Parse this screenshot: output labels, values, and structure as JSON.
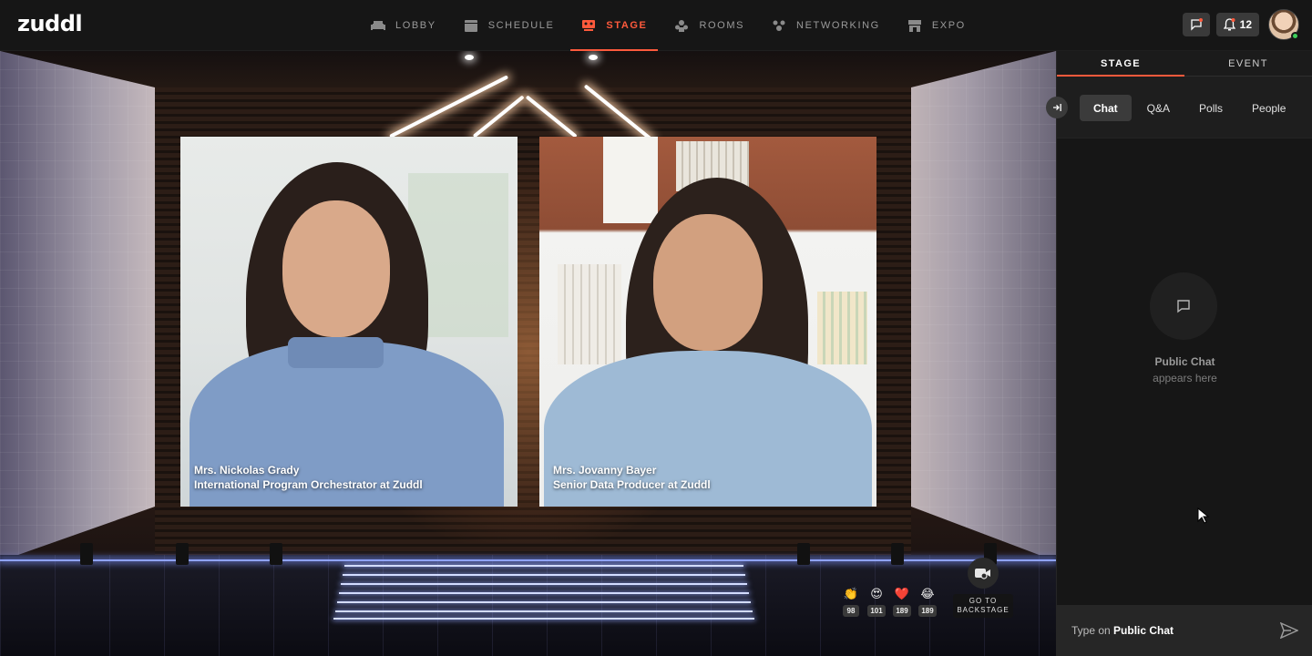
{
  "brand": {
    "logo_text": "zuddl",
    "accent": "#ff5a3c"
  },
  "nav": {
    "items": [
      {
        "label": "LOBBY",
        "icon": "sofa-icon",
        "active": false
      },
      {
        "label": "SCHEDULE",
        "icon": "calendar-icon",
        "active": false
      },
      {
        "label": "STAGE",
        "icon": "stage-icon",
        "active": true
      },
      {
        "label": "ROOMS",
        "icon": "rooms-icon",
        "active": false
      },
      {
        "label": "NETWORKING",
        "icon": "networking-icon",
        "active": false
      },
      {
        "label": "EXPO",
        "icon": "expo-icon",
        "active": false
      }
    ]
  },
  "header_actions": {
    "notifications_count": "12"
  },
  "speakers": [
    {
      "name": "Mrs. Nickolas Grady",
      "title": "International Program Orchestrator at Zuddl"
    },
    {
      "name": "Mrs. Jovanny Bayer",
      "title": "Senior Data Producer at Zuddl"
    }
  ],
  "reactions": [
    {
      "emoji": "👏",
      "count": "98"
    },
    {
      "emoji": "😍",
      "count": "101"
    },
    {
      "emoji": "❤️",
      "count": "189"
    },
    {
      "emoji": "😂",
      "count": "189"
    }
  ],
  "backstage": {
    "line1": "GO TO",
    "line2": "BACKSTAGE"
  },
  "panel": {
    "tabs": [
      "STAGE",
      "EVENT"
    ],
    "subtabs": [
      "Chat",
      "Q&A",
      "Polls",
      "People"
    ],
    "empty_title": "Public Chat",
    "empty_sub": "appears here",
    "composer_prefix": "Type on",
    "composer_target": "Public Chat"
  }
}
